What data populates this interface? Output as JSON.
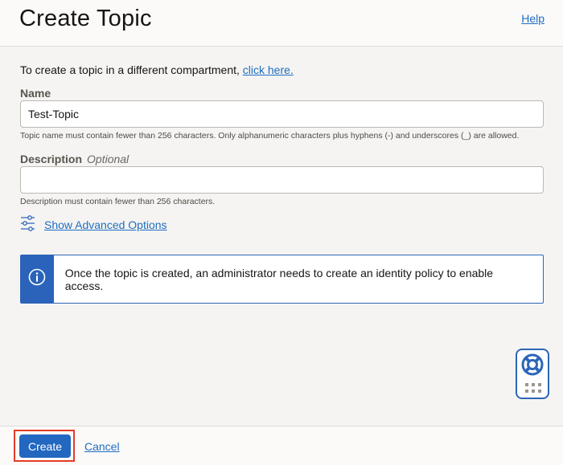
{
  "header": {
    "title": "Create Topic",
    "help_label": "Help"
  },
  "intro": {
    "text": "To create a topic in a different compartment, ",
    "link": "click here."
  },
  "name_field": {
    "label": "Name",
    "value": "Test-Topic",
    "hint": "Topic name must contain fewer than 256 characters. Only alphanumeric characters plus hyphens (-) and underscores (_) are allowed."
  },
  "description_field": {
    "label": "Description",
    "optional_label": "Optional",
    "value": "",
    "hint": "Description must contain fewer than 256 characters."
  },
  "advanced": {
    "label": "Show Advanced Options",
    "icon": "sliders-icon"
  },
  "info": {
    "icon": "info-icon",
    "message": "Once the topic is created, an administrator needs to create an identity policy to enable access."
  },
  "help_widget": {
    "icons": [
      "lifebuoy-icon",
      "grid-icon"
    ]
  },
  "footer": {
    "create_label": "Create",
    "cancel_label": "Cancel"
  },
  "colors": {
    "accent": "#2267c0",
    "link": "#1f6ec2",
    "highlight": "#e53b26",
    "background": "#f5f4f2"
  }
}
